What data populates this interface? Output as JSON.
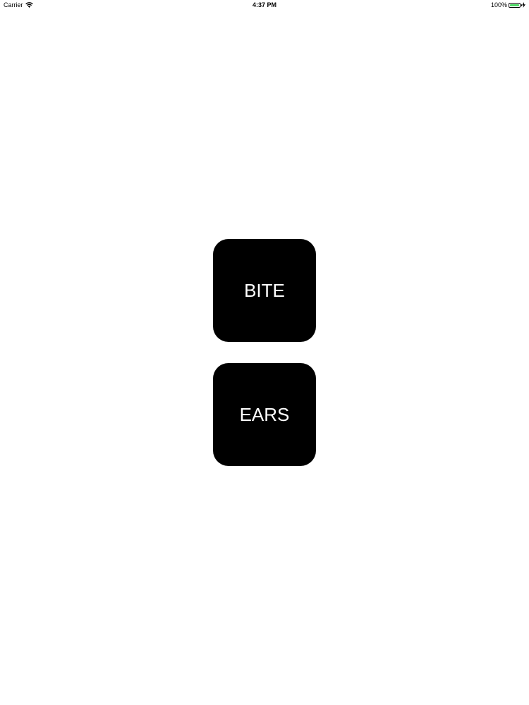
{
  "status_bar": {
    "carrier": "Carrier",
    "time": "4:37 PM",
    "battery_percent": "100%",
    "battery_level": 1.0,
    "battery_color": "#4cd964",
    "wifi_icon": "wifi-icon",
    "battery_icon": "battery-icon",
    "charging_icon": "charging-bolt-icon"
  },
  "buttons": {
    "bite_label": "BITE",
    "ears_label": "EARS",
    "background_color": "#000000",
    "text_color": "#ffffff"
  }
}
